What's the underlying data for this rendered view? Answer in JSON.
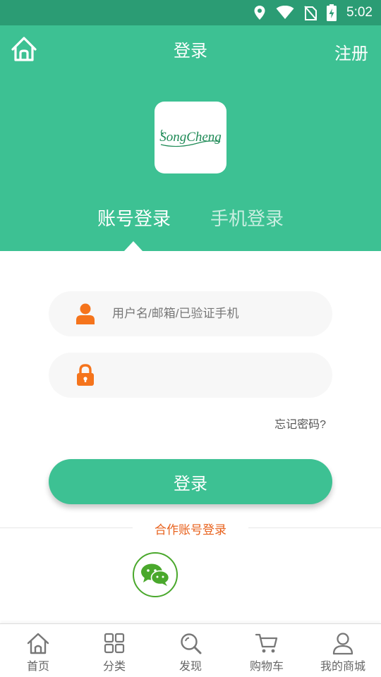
{
  "status_bar": {
    "time": "5:02"
  },
  "header": {
    "title": "登录",
    "register_label": "注册",
    "logo_text": "SongCheng"
  },
  "tabs": [
    {
      "label": "账号登录",
      "active": true
    },
    {
      "label": "手机登录",
      "active": false
    }
  ],
  "form": {
    "username_placeholder": "用户名/邮箱/已验证手机",
    "username_value": "",
    "password_value": "",
    "forgot_label": "忘记密码?",
    "login_label": "登录"
  },
  "partner": {
    "label": "合作账号登录",
    "wechat_icon": "wechat-icon"
  },
  "bottom_nav": [
    {
      "label": "首页",
      "icon": "home-icon"
    },
    {
      "label": "分类",
      "icon": "grid-icon"
    },
    {
      "label": "发现",
      "icon": "search-icon"
    },
    {
      "label": "购物车",
      "icon": "cart-icon"
    },
    {
      "label": "我的商城",
      "icon": "user-icon"
    }
  ],
  "colors": {
    "accent": "#3dc193",
    "status_bar": "#2b9c74",
    "icon_orange": "#f5741c",
    "partner_text": "#e8621d",
    "wechat_green": "#4aa82c"
  }
}
